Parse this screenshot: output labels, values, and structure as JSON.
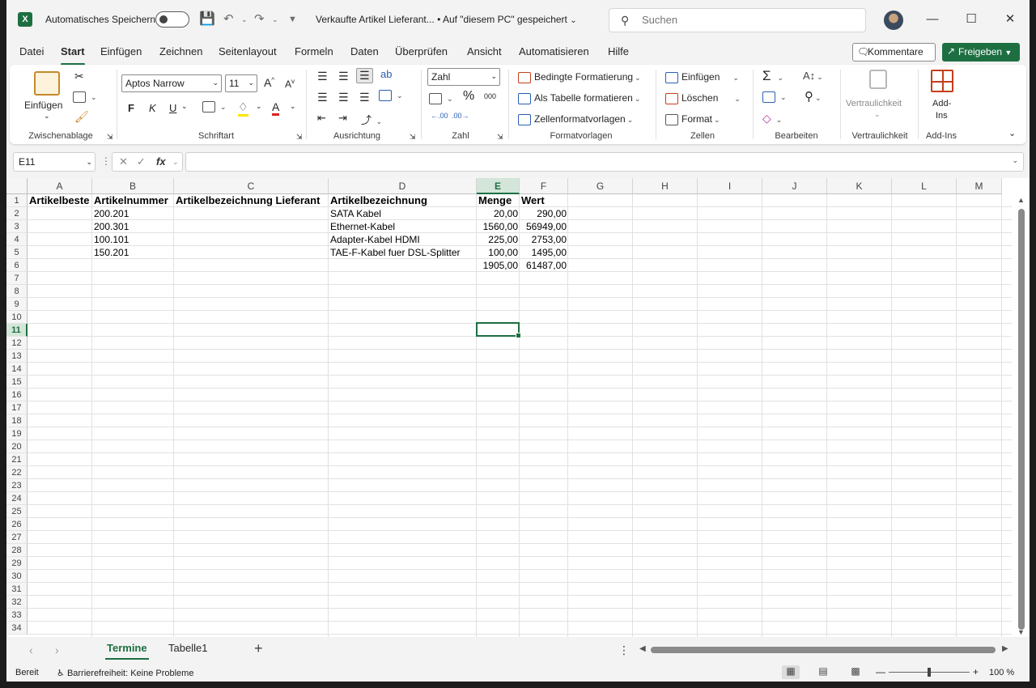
{
  "titlebar": {
    "autosave_label": "Automatisches Speichern",
    "doc_title": "Verkaufte Artikel Lieferant...  •  Auf \"diesem PC\" gespeichert",
    "search_placeholder": "Suchen"
  },
  "ribbon_tabs": [
    "Datei",
    "Start",
    "Einfügen",
    "Zeichnen",
    "Seitenlayout",
    "Formeln",
    "Daten",
    "Überprüfen",
    "Ansicht",
    "Automatisieren",
    "Hilfe"
  ],
  "active_tab": "Start",
  "actions": {
    "comments": "Kommentare",
    "share": "Freigeben"
  },
  "ribbon": {
    "clipboard": {
      "paste": "Einfügen",
      "label": "Zwischenablage"
    },
    "font": {
      "name": "Aptos Narrow",
      "size": "11",
      "bold": "F",
      "italic": "K",
      "underline": "U",
      "label": "Schriftart"
    },
    "alignment": {
      "label": "Ausrichtung"
    },
    "number": {
      "format": "Zahl",
      "label": "Zahl"
    },
    "styles": {
      "conditional": "Bedingte Formatierung",
      "as_table": "Als Tabelle formatieren",
      "cell_styles": "Zellenformatvorlagen",
      "label": "Formatvorlagen"
    },
    "cells": {
      "insert": "Einfügen",
      "delete": "Löschen",
      "format": "Format",
      "label": "Zellen"
    },
    "editing": {
      "label": "Bearbeiten"
    },
    "sensitivity": {
      "button": "Vertraulichkeit",
      "label": "Vertraulichkeit"
    },
    "addins": {
      "button_line1": "Add-",
      "button_line2": "Ins",
      "label": "Add-Ins"
    }
  },
  "formula_bar": {
    "name_box": "E11",
    "fx": "fx",
    "content": ""
  },
  "grid": {
    "columns": [
      "A",
      "B",
      "C",
      "D",
      "E",
      "F",
      "G",
      "H",
      "I",
      "J",
      "K",
      "L",
      "M"
    ],
    "selected_column": "E",
    "rows": [
      "1",
      "2",
      "3",
      "4",
      "5",
      "6",
      "7",
      "8",
      "9",
      "10",
      "11",
      "12",
      "13",
      "14",
      "15",
      "16",
      "17",
      "18",
      "19",
      "20",
      "21",
      "22",
      "23",
      "24",
      "25",
      "26",
      "27",
      "28",
      "29",
      "30",
      "31",
      "32",
      "33",
      "34"
    ],
    "selected_row": "11",
    "header_row": [
      "Artikelbeste",
      "Artikelnummer",
      "Artikelbezeichnung Lieferant",
      "Artikelbezeichnung",
      "Menge",
      "Wert"
    ],
    "data": [
      [
        "",
        "200.201",
        "",
        "SATA Kabel",
        "20,00",
        "290,00"
      ],
      [
        "",
        "200.301",
        "",
        "Ethernet-Kabel",
        "1560,00",
        "56949,00"
      ],
      [
        "",
        "100.101",
        "",
        "Adapter-Kabel HDMI",
        "225,00",
        "2753,00"
      ],
      [
        "",
        "150.201",
        "",
        "TAE-F-Kabel fuer DSL-Splitter",
        "100,00",
        "1495,00"
      ],
      [
        "",
        "",
        "",
        "",
        "1905,00",
        "61487,00"
      ]
    ]
  },
  "sheets": {
    "tabs": [
      "Termine",
      "Tabelle1"
    ],
    "active": "Termine"
  },
  "status": {
    "ready": "Bereit",
    "accessibility": "Barrierefreiheit: Keine Probleme",
    "zoom": "100 %"
  }
}
